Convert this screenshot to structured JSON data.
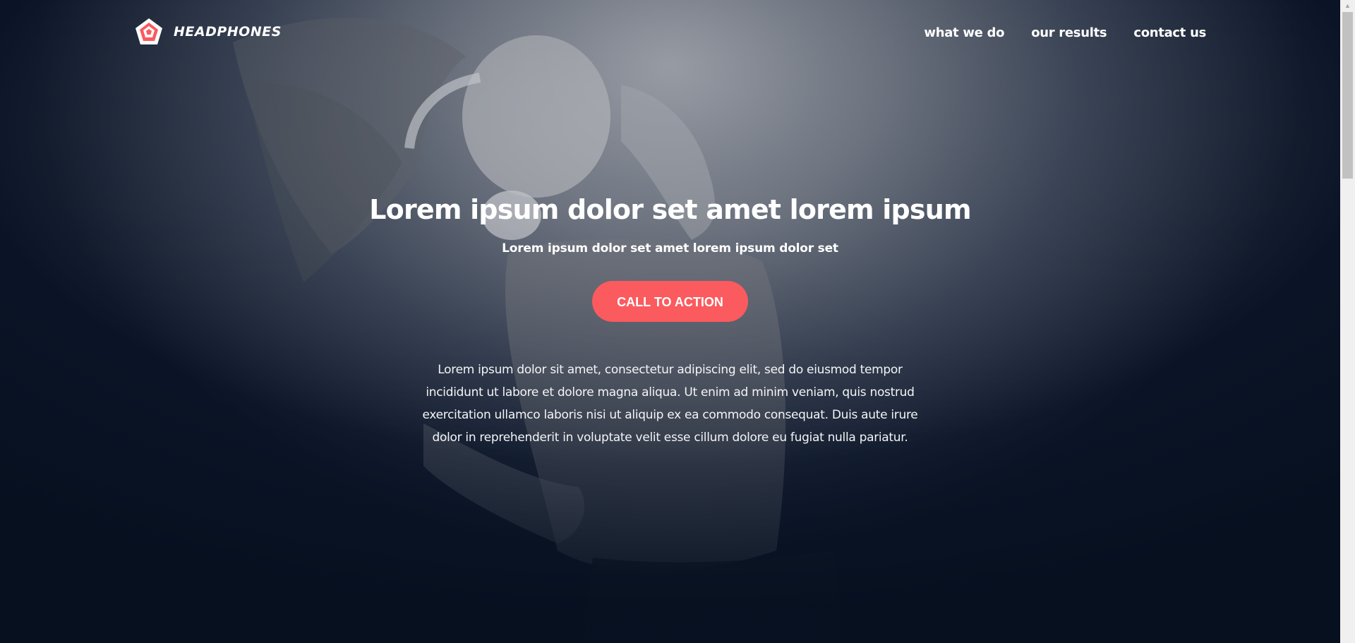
{
  "brand": {
    "name": "HEADPHONES"
  },
  "nav": {
    "items": [
      {
        "label": "what we do"
      },
      {
        "label": "our results"
      },
      {
        "label": "contact us"
      }
    ]
  },
  "hero": {
    "title": "Lorem ipsum dolor set amet lorem ipsum",
    "subtitle": "Lorem ipsum dolor set amet lorem ipsum dolor set",
    "cta_label": "CALL TO ACTION",
    "paragraph": "Lorem ipsum dolor sit amet, consectetur adipiscing elit, sed do eiusmod tempor incididunt ut labore et dolore magna aliqua. Ut enim ad minim veniam, quis nostrud exercitation ullamco laboris nisi ut aliquip ex ea commodo consequat. Duis aute irure dolor in reprehenderit in voluptate velit esse cillum dolore eu fugiat nulla pariatur."
  },
  "colors": {
    "accent": "#fb5a5e",
    "background_dark": "#0b1526",
    "text": "#ffffff"
  },
  "icons": {
    "logo": "pentagon-logo-icon",
    "scroll_up": "scroll-up-arrow-icon"
  }
}
